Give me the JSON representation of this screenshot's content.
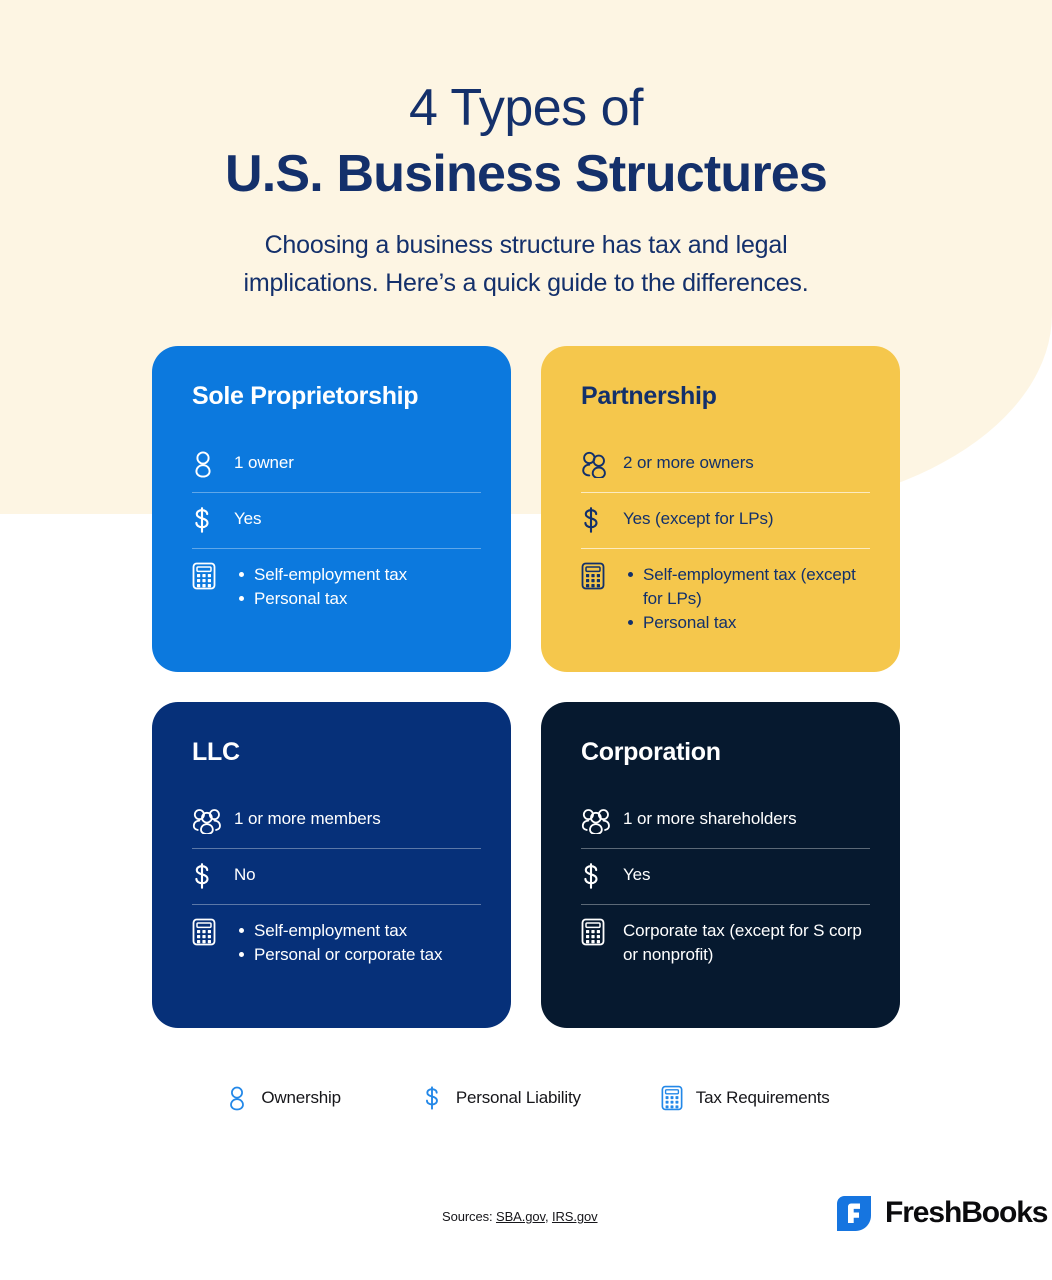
{
  "header": {
    "title_line1": "4 Types of",
    "title_line2": "U.S. Business Structures",
    "subtitle_line1": "Choosing a business structure has tax and legal",
    "subtitle_line2": "implications. Here’s a quick guide to the differences.",
    "title_color": "#14306B"
  },
  "cards": [
    {
      "title": "Sole Proprietorship",
      "bg_color": "#0C79DE",
      "text_color": "#FFFFFF",
      "ownership_icon": "person-icon",
      "ownership": "1 owner",
      "liability_icon": "dollar-icon",
      "liability": "Yes",
      "tax_icon": "calculator-icon",
      "tax_items": [
        "Self-employment tax",
        "Personal tax"
      ],
      "tax_is_list": true
    },
    {
      "title": "Partnership",
      "bg_color": "#F5C74C",
      "text_color": "#12306B",
      "ownership_icon": "two-people-icon",
      "ownership": "2 or more owners",
      "liability_icon": "dollar-icon",
      "liability": "Yes (except for LPs)",
      "tax_icon": "calculator-icon",
      "tax_items": [
        "Self-employment tax (except for LPs)",
        "Personal tax"
      ],
      "tax_is_list": true
    },
    {
      "title": "LLC",
      "bg_color": "#063079",
      "text_color": "#FFFFFF",
      "ownership_icon": "three-people-icon",
      "ownership": "1 or more members",
      "liability_icon": "dollar-icon",
      "liability": "No",
      "tax_icon": "calculator-icon",
      "tax_items": [
        "Self-employment tax",
        "Personal or corporate tax"
      ],
      "tax_is_list": true
    },
    {
      "title": "Corporation",
      "bg_color": "#06192F",
      "text_color": "#FFFFFF",
      "ownership_icon": "three-people-icon",
      "ownership": "1 or more shareholders",
      "liability_icon": "dollar-icon",
      "liability": "Yes",
      "tax_icon": "calculator-icon",
      "tax_items": [
        "Corporate tax (except for S corp  or nonprofit)"
      ],
      "tax_is_list": false
    }
  ],
  "legend": {
    "accent_color": "#2388E8",
    "items": [
      {
        "icon": "person-icon",
        "label": "Ownership"
      },
      {
        "icon": "dollar-icon",
        "label": "Personal Liability"
      },
      {
        "icon": "calculator-icon",
        "label": "Tax Requirements"
      }
    ]
  },
  "footer": {
    "sources_prefix": "Sources: ",
    "source_1": "SBA.gov",
    "sources_separator": ", ",
    "source_2": "IRS.gov",
    "brand_name": "FreshBooks",
    "brand_color": "#1675E0",
    "brand_letter": "F"
  }
}
